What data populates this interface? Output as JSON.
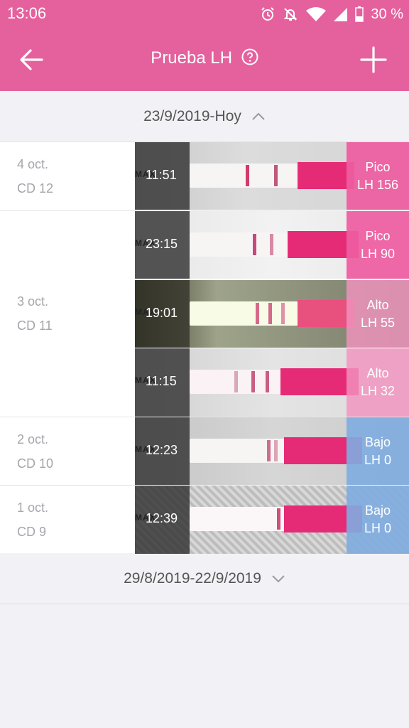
{
  "status": {
    "time": "13:06",
    "battery": "30 %",
    "icons": [
      "alarm-icon",
      "bell-off-icon",
      "wifi-icon",
      "signal-icon",
      "battery-icon"
    ]
  },
  "appbar": {
    "title": "Prueba LH",
    "back_icon": "arrow-left-icon",
    "help_icon": "help-circle-icon",
    "add_icon": "plus-icon"
  },
  "ranges": {
    "current": "23/9/2019-Hoy",
    "previous": "29/8/2019-22/9/2019"
  },
  "colors": {
    "brand": "#e5619e",
    "pico": "#ee5ca0",
    "alto": "#f194be",
    "bajo": "#80ace0"
  },
  "groups": [
    {
      "date": "4 oct.",
      "cycle_day": "CD 12",
      "tests": [
        {
          "time": "11:51",
          "status": "Pico",
          "lh": "LH 156"
        }
      ]
    },
    {
      "date": "3 oct.",
      "cycle_day": "CD 11",
      "tests": [
        {
          "time": "23:15",
          "status": "Pico",
          "lh": "LH 90"
        },
        {
          "time": "19:01",
          "status": "Alto",
          "lh": "LH 55"
        },
        {
          "time": "11:15",
          "status": "Alto",
          "lh": "LH 32"
        }
      ]
    },
    {
      "date": "2 oct.",
      "cycle_day": "CD 10",
      "tests": [
        {
          "time": "12:23",
          "status": "Bajo",
          "lh": "LH 0"
        }
      ]
    },
    {
      "date": "1 oct.",
      "cycle_day": "CD 9",
      "tests": [
        {
          "time": "12:39",
          "status": "Bajo",
          "lh": "LH 0"
        }
      ]
    }
  ]
}
